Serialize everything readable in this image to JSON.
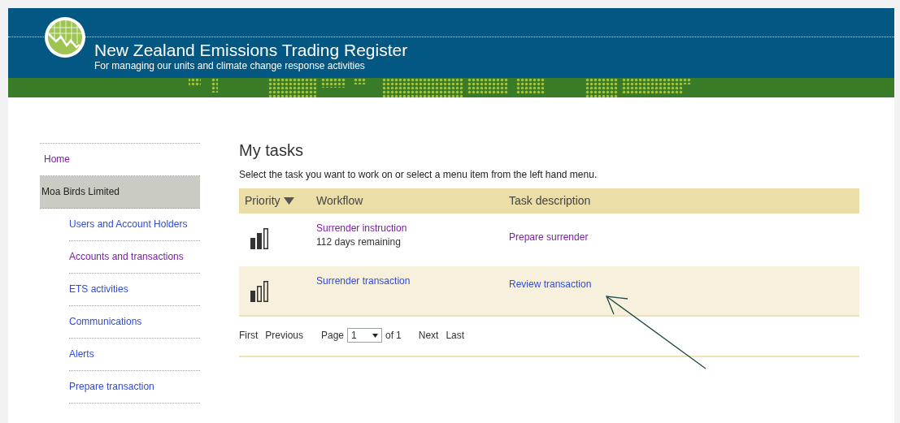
{
  "header": {
    "title": "New Zealand Emissions Trading Register",
    "subtitle": "For managing our units and climate change response activities"
  },
  "sidebar": {
    "items": [
      {
        "label": "Home",
        "selected": false,
        "visited": true
      },
      {
        "label": "Moa Birds Limited",
        "selected": true,
        "children": [
          {
            "label": "Users and Account Holders",
            "selected": false,
            "visited": false
          },
          {
            "label": "Accounts and transactions",
            "selected": false,
            "visited": true
          },
          {
            "label": "ETS activities",
            "selected": false,
            "visited": false
          },
          {
            "label": "Communications",
            "selected": false,
            "visited": false
          },
          {
            "label": "Alerts",
            "selected": false,
            "visited": false
          },
          {
            "label": "Prepare transaction",
            "selected": false,
            "visited": false
          }
        ]
      }
    ]
  },
  "main": {
    "title": "My tasks",
    "intro": "Select the task you want to work on or select a menu item from the left hand menu.",
    "table": {
      "columns": [
        "Priority",
        "Workflow",
        "Task description"
      ],
      "rows": [
        {
          "level": 0.67,
          "workflow": "Surrender instruction",
          "workflow_visited": true,
          "note": "112 days remaining",
          "task": "Prepare surrender",
          "task_visited": true,
          "selected": false
        },
        {
          "level": 0.33,
          "workflow": "Surrender transaction",
          "workflow_visited": false,
          "task": "Review transaction",
          "task_visited": false,
          "selected": true
        }
      ]
    },
    "pager": {
      "first": "First",
      "previous": "Previous",
      "page_label": "Page",
      "page_value": "1",
      "of_label": "of",
      "total": "1",
      "next": "Next",
      "last": "Last"
    }
  }
}
